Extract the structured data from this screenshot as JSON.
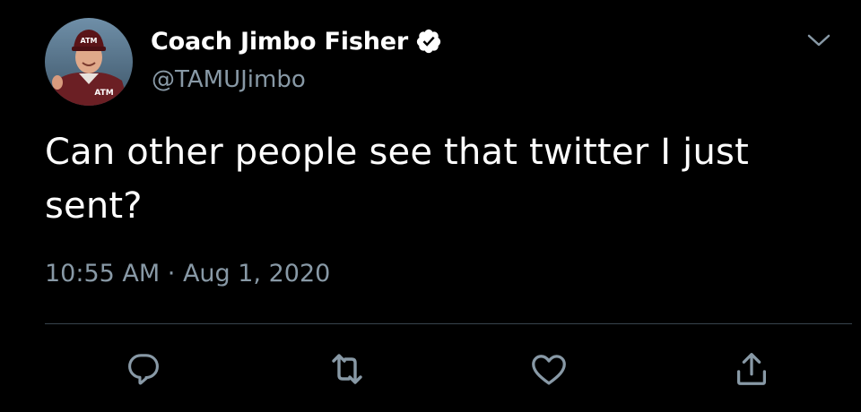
{
  "tweet": {
    "author": {
      "display_name": "Coach Jimbo Fisher",
      "handle": "@TAMUJimbo",
      "verified": true,
      "avatar_icon": "profile-photo"
    },
    "text": "Can other people see that twitter I just sent?",
    "time": "10:55 AM",
    "separator": "·",
    "date": "Aug 1, 2020",
    "actions": [
      {
        "name": "reply",
        "icon": "speech-bubble-icon"
      },
      {
        "name": "retweet",
        "icon": "retweet-arrows-icon"
      },
      {
        "name": "like",
        "icon": "heart-icon"
      },
      {
        "name": "share",
        "icon": "share-upload-icon"
      }
    ]
  },
  "colors": {
    "background": "#000000",
    "primary_text": "#ffffff",
    "secondary_text": "#8899a6",
    "divider": "#38444d",
    "verified_badge": "#ffffff"
  }
}
